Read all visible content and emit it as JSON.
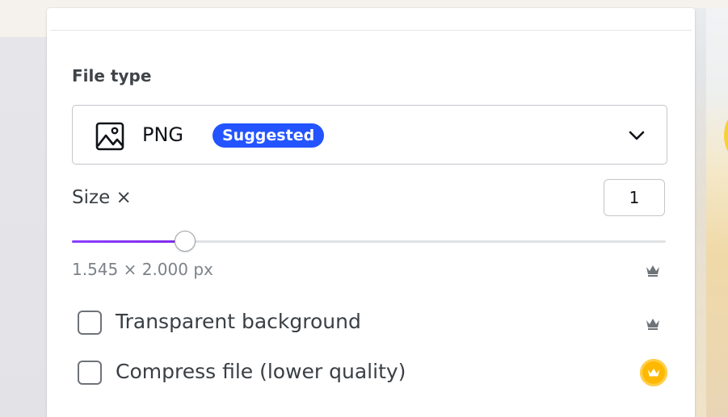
{
  "panel": {
    "file_type_label": "File type",
    "file_type": {
      "icon": "image-icon",
      "value": "PNG",
      "badge": "Suggested",
      "chevron": "chevron-down-icon"
    },
    "size": {
      "label": "Size ×",
      "value": "1",
      "slider_fraction": 0.19,
      "dimensions": "1.545 × 2.000 px",
      "premium_icon": "crown-icon"
    },
    "options": [
      {
        "label": "Transparent background",
        "checked": false,
        "premium_icon": "crown-icon"
      },
      {
        "label": "Compress file (lower quality)",
        "checked": false,
        "premium_icon": "crown-gold-icon"
      }
    ]
  },
  "colors": {
    "accent": "#2354ff",
    "slider_fill": "#8b3dff",
    "premium_gold": "#ffb800"
  }
}
